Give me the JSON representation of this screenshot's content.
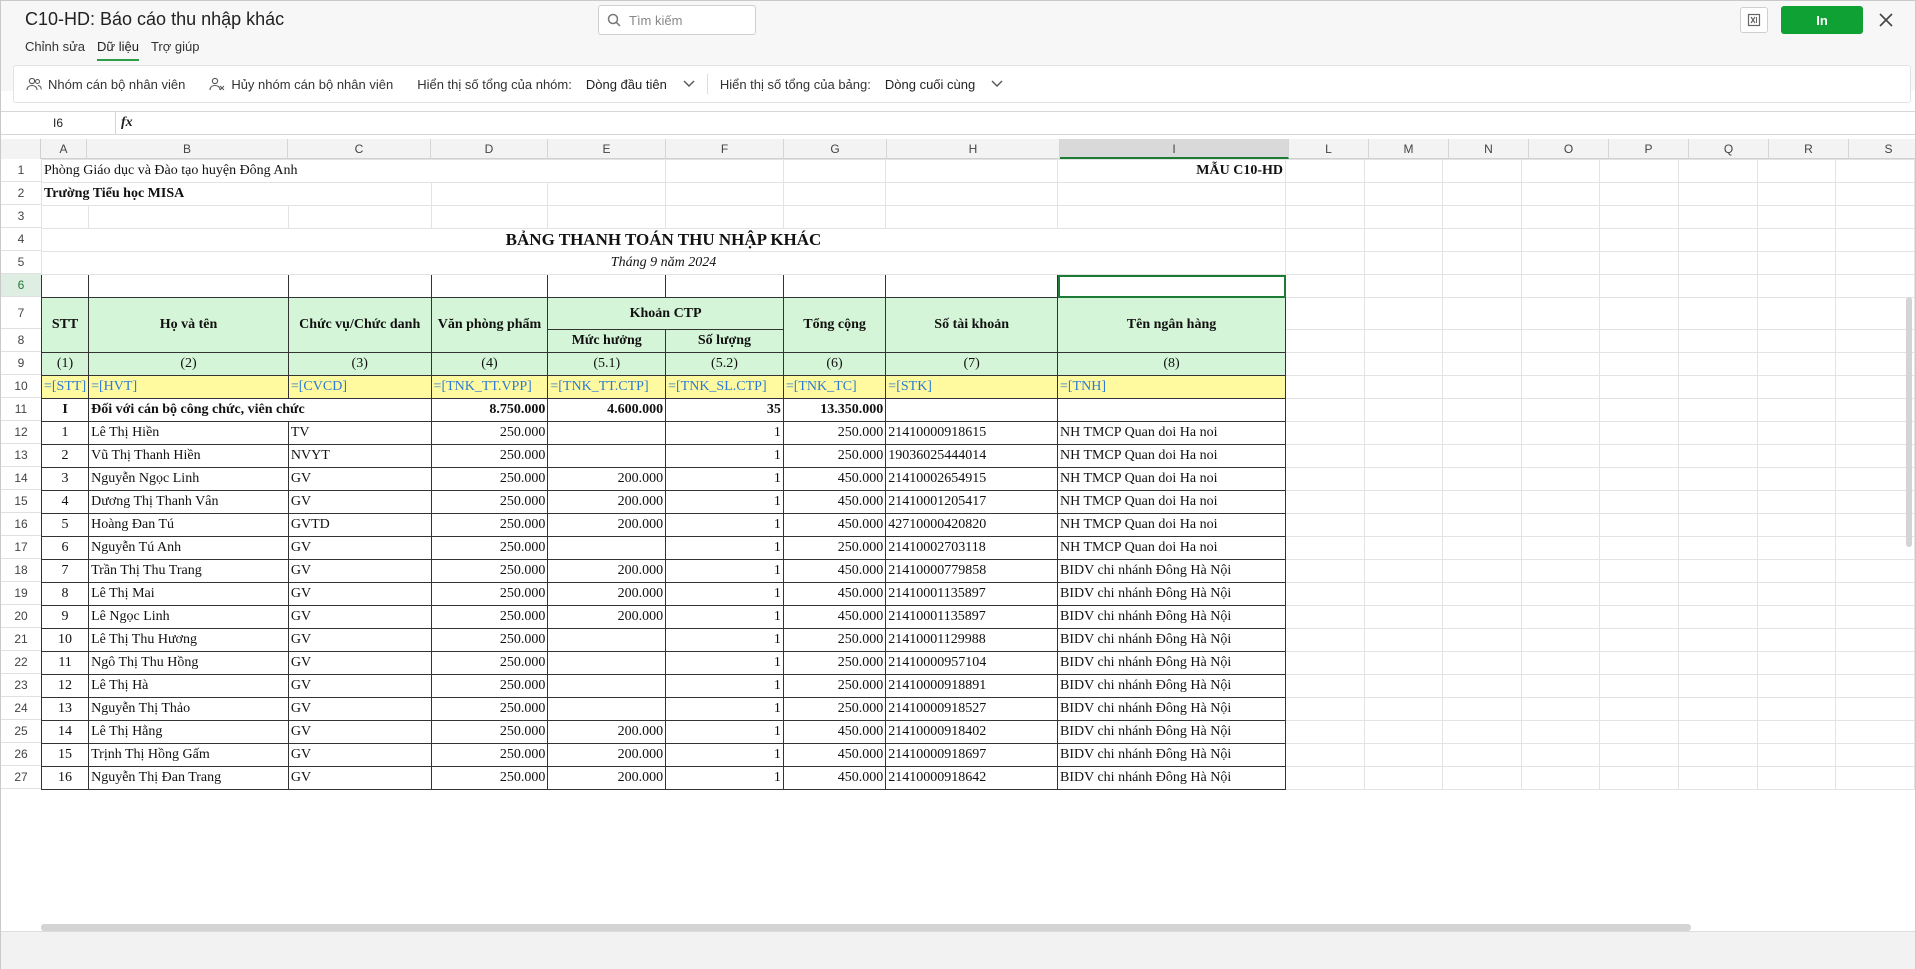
{
  "app": {
    "title": "C10-HD: Báo cáo thu nhập khác",
    "search_placeholder": "Tìm kiếm",
    "print_label": "In",
    "colors": {
      "accent": "#10a135",
      "header_fill": "#d5f5d8",
      "token_fill": "#fffaa0",
      "token_text": "#2b7bd6"
    }
  },
  "tabs": [
    {
      "label": "Chỉnh sửa",
      "active": false
    },
    {
      "label": "Dữ liệu",
      "active": true
    },
    {
      "label": "Trợ giúp",
      "active": false
    }
  ],
  "ribbon": {
    "group_label": "Nhóm cán bộ nhân viên",
    "ungroup_label": "Hủy nhóm cán bộ nhân viên",
    "group_total_label": "Hiển thị số tổng của nhóm:",
    "group_total_value": "Dòng đầu tiên",
    "table_total_label": "Hiển thị số tổng của bảng:",
    "table_total_value": "Dòng cuối cùng"
  },
  "formula_bar": {
    "cell_ref": "I6",
    "fx_label": "fx",
    "content": ""
  },
  "columns": [
    "A",
    "B",
    "C",
    "D",
    "E",
    "F",
    "G",
    "H",
    "I",
    "L",
    "M",
    "N",
    "O",
    "P",
    "Q",
    "R",
    "S"
  ],
  "selected_column": "I",
  "selected_row": "6",
  "rows": [
    "1",
    "2",
    "3",
    "4",
    "5",
    "6",
    "7",
    "8",
    "9",
    "10",
    "11",
    "12",
    "13",
    "14",
    "15",
    "16",
    "17",
    "18",
    "19",
    "20",
    "21",
    "22",
    "23",
    "24",
    "25",
    "26",
    "27"
  ],
  "sheet": {
    "org": "Phòng Giáo dục và Đào tạo huyện Đông Anh",
    "school": "Trường Tiểu học MISA",
    "form_code": "MẪU C10-HD",
    "report_title": "BẢNG THANH TOÁN THU NHẬP KHÁC",
    "period": "Tháng 9 năm 2024",
    "headers": {
      "stt": "STT",
      "name": "Họ và tên",
      "position": "Chức vụ/Chức danh",
      "office": "Văn phòng phẩm",
      "ctp": "Khoản CTP",
      "ctp_rate": "Mức hưởng",
      "ctp_qty": "Số lượng",
      "total": "Tổng cộng",
      "account": "Số tài khoản",
      "bank": "Tên ngân hàng"
    },
    "index_row": [
      "(1)",
      "(2)",
      "(3)",
      "(4)",
      "(5.1)",
      "(5.2)",
      "(6)",
      "(7)",
      "(8)"
    ],
    "token_row": [
      "=[STT]",
      "=[HVT]",
      "=[CVCD]",
      "=[TNK_TT.VPP]",
      "=[TNK_TT.CTP]",
      "=[TNK_SL.CTP]",
      "=[TNK_TC]",
      "=[STK]",
      "=[TNH]"
    ],
    "group": {
      "stt": "I",
      "name": "Đối với cán bộ công chức, viên chức",
      "office": "8.750.000",
      "ctp_rate": "4.600.000",
      "ctp_qty": "35",
      "total": "13.350.000"
    },
    "staff": [
      [
        "1",
        "Lê Thị Hiền",
        "TV",
        "250.000",
        "",
        "1",
        "250.000",
        "21410000918615",
        "NH TMCP Quan doi Ha noi"
      ],
      [
        "2",
        "Vũ Thị Thanh Hiền",
        "NVYT",
        "250.000",
        "",
        "1",
        "250.000",
        "19036025444014",
        "NH TMCP Quan doi Ha noi"
      ],
      [
        "3",
        "Nguyễn Ngọc Linh",
        "GV",
        "250.000",
        "200.000",
        "1",
        "450.000",
        "21410002654915",
        "NH TMCP Quan doi Ha noi"
      ],
      [
        "4",
        "Dương Thị Thanh Vân",
        "GV",
        "250.000",
        "200.000",
        "1",
        "450.000",
        "21410001205417",
        "NH TMCP Quan doi Ha noi"
      ],
      [
        "5",
        "Hoàng Đan Tú",
        "GVTD",
        "250.000",
        "200.000",
        "1",
        "450.000",
        "42710000420820",
        "NH TMCP Quan doi Ha noi"
      ],
      [
        "6",
        "Nguyễn Tú Anh",
        "GV",
        "250.000",
        "",
        "1",
        "250.000",
        "21410002703118",
        "NH TMCP Quan doi Ha noi"
      ],
      [
        "7",
        "Trần Thị Thu Trang",
        "GV",
        "250.000",
        "200.000",
        "1",
        "450.000",
        "21410000779858",
        "BIDV chi nhánh Đông Hà Nội"
      ],
      [
        "8",
        "Lê Thị Mai",
        "GV",
        "250.000",
        "200.000",
        "1",
        "450.000",
        "21410001135897",
        "BIDV chi nhánh Đông Hà Nội"
      ],
      [
        "9",
        "Lê Ngọc Linh",
        "GV",
        "250.000",
        "200.000",
        "1",
        "450.000",
        "21410001135897",
        "BIDV chi nhánh Đông Hà Nội"
      ],
      [
        "10",
        "Lê Thị Thu Hương",
        "GV",
        "250.000",
        "",
        "1",
        "250.000",
        "21410001129988",
        "BIDV chi nhánh Đông Hà Nội"
      ],
      [
        "11",
        "Ngô Thị Thu Hồng",
        "GV",
        "250.000",
        "",
        "1",
        "250.000",
        "21410000957104",
        "BIDV chi nhánh Đông Hà Nội"
      ],
      [
        "12",
        "Lê Thị Hà",
        "GV",
        "250.000",
        "",
        "1",
        "250.000",
        "21410000918891",
        "BIDV chi nhánh Đông Hà Nội"
      ],
      [
        "13",
        "Nguyễn Thị Thảo",
        "GV",
        "250.000",
        "",
        "1",
        "250.000",
        "21410000918527",
        "BIDV chi nhánh Đông Hà Nội"
      ],
      [
        "14",
        "Lê Thị Hằng",
        "GV",
        "250.000",
        "200.000",
        "1",
        "450.000",
        "21410000918402",
        "BIDV chi nhánh Đông Hà Nội"
      ],
      [
        "15",
        "Trịnh Thị Hồng Gấm",
        "GV",
        "250.000",
        "200.000",
        "1",
        "450.000",
        "21410000918697",
        "BIDV chi nhánh Đông Hà Nội"
      ],
      [
        "16",
        "Nguyễn Thị  Đan Trang",
        "GV",
        "250.000",
        "200.000",
        "1",
        "450.000",
        "21410000918642",
        "BIDV chi nhánh Đông Hà Nội"
      ]
    ]
  }
}
